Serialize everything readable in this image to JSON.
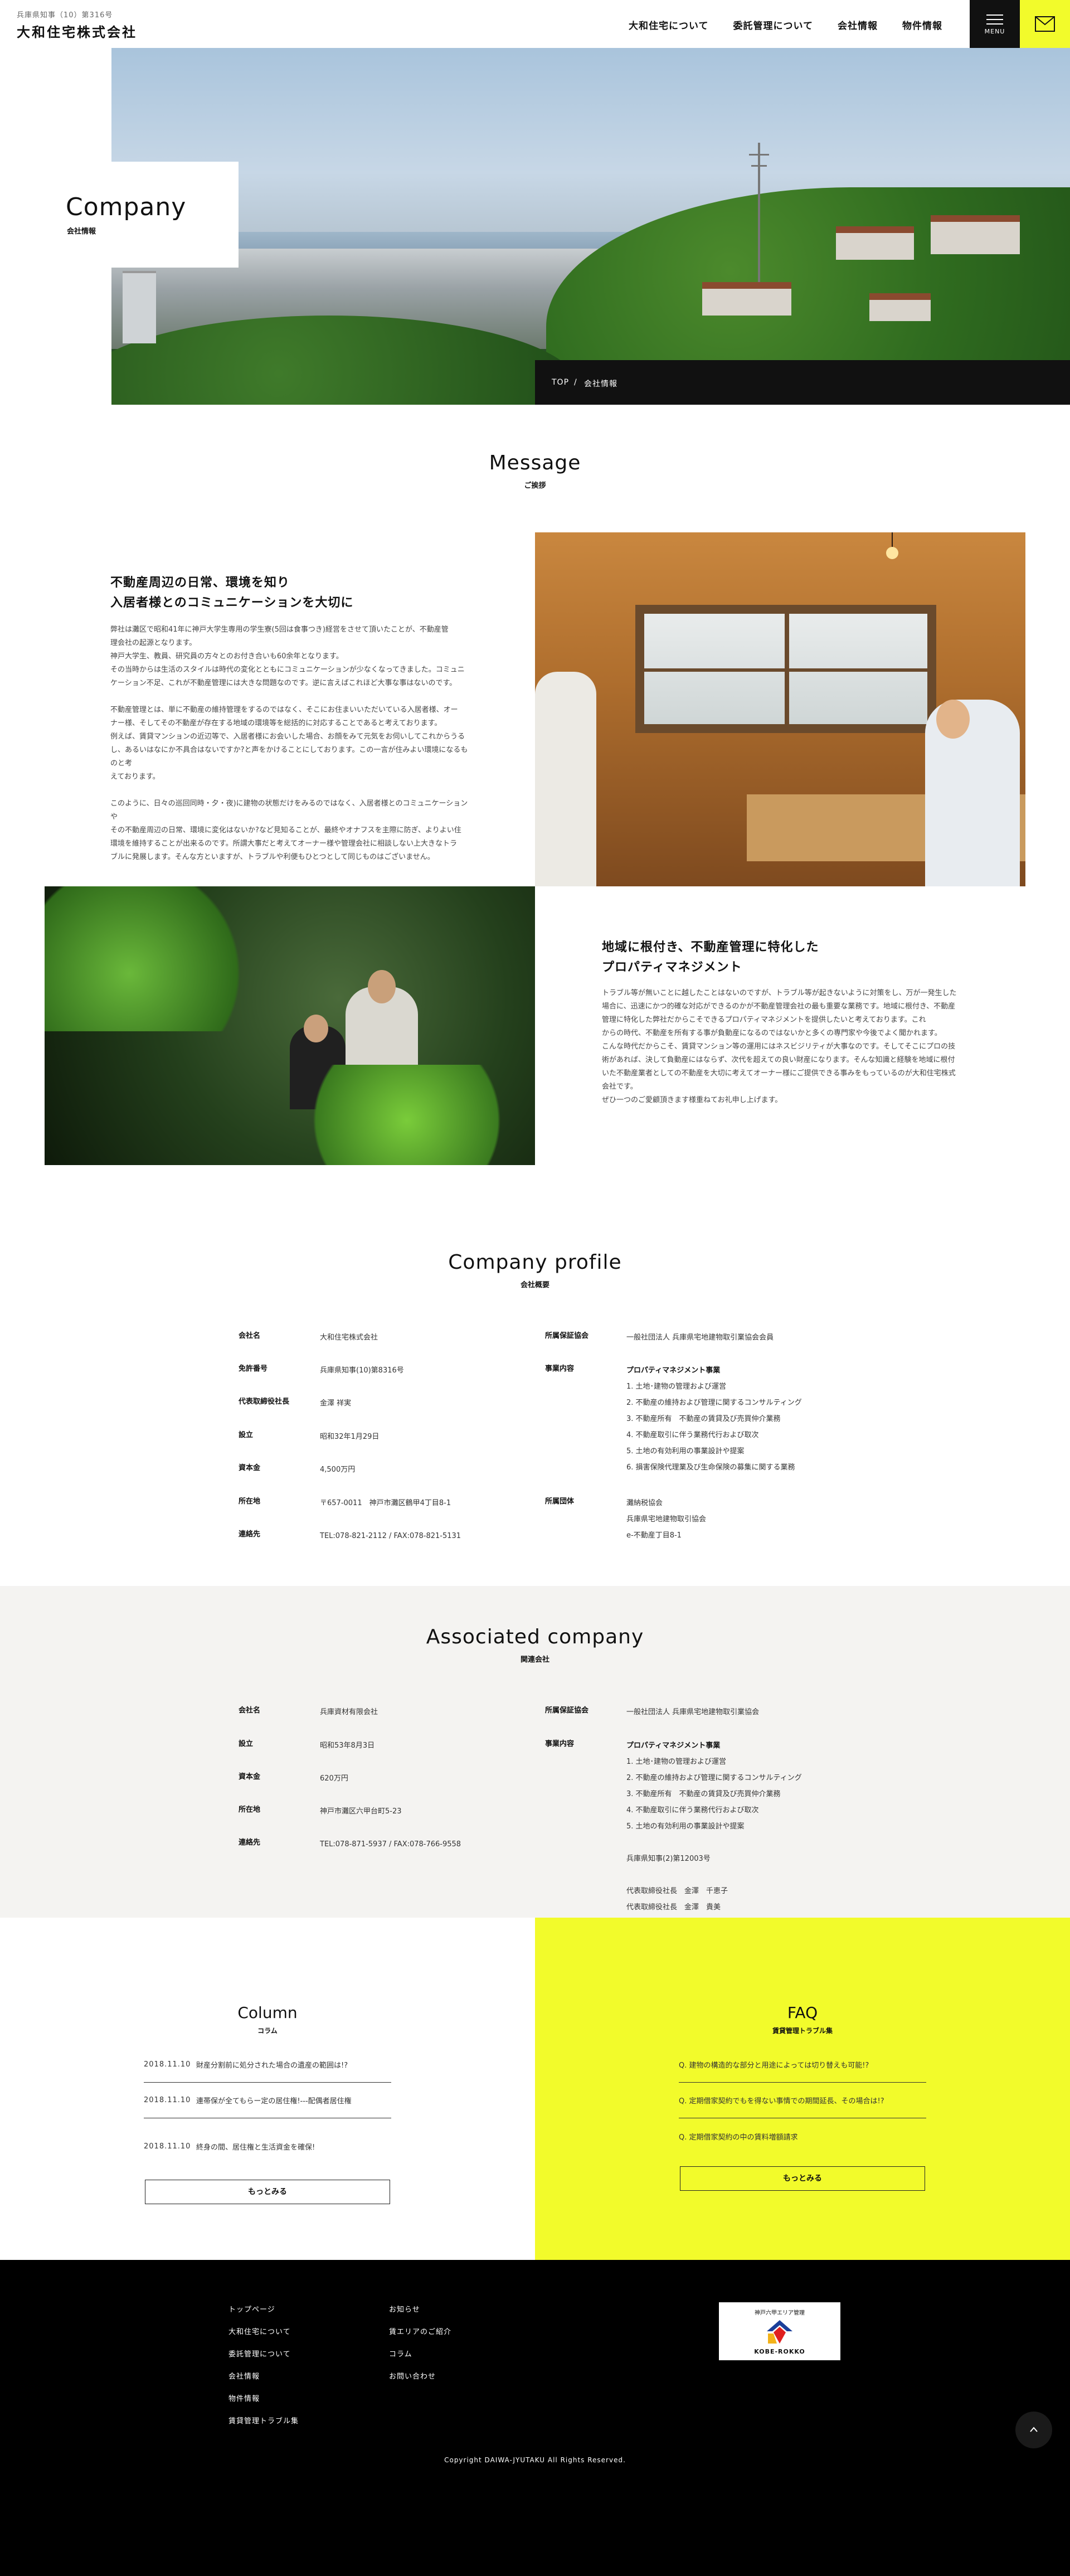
{
  "header": {
    "license": "兵庫県知事（10）第316号",
    "logo": "大和住宅株式会社",
    "nav": [
      "大和住宅について",
      "委託管理について",
      "会社情報",
      "物件情報"
    ],
    "menu_label": "MENU"
  },
  "hero": {
    "title_en": "Company",
    "title_jp": "会社情報",
    "breadcrumb": [
      "TOP",
      "/",
      "会社情報"
    ]
  },
  "message": {
    "title_en": "Message",
    "title_jp": "ご挨拶",
    "block1": {
      "heading": [
        "不動産周辺の日常、環境を知り",
        "入居者様とのコミュニケーションを大切に"
      ],
      "paragraphs": [
        [
          "弊社は灘区で昭和41年に神戸大学生専用の学生寮(5回は食事つき)経営をさせて頂いたことが、不動産管",
          "理会社の起源となります。",
          "神戸大学生、教員、研究員の方々とのお付き合いも60余年となります。",
          "その当時からは生活のスタイルは時代の変化とともにコミュニケーションが少なくなってきました。コミュニ",
          "ケーション不足、これが不動産管理には大きな問題なのです。逆に言えばこれほど大事な事はないのです。"
        ],
        [
          "不動産管理とは、単に不動産の維持管理をするのではなく、そこにお住まいいただいている入居者様、オー",
          "ナー様、そしてその不動産が存在する地域の環境等を総括的に対応することであると考えております。",
          "例えば、賃貸マンションの近辺等で、入居者様にお会いした場合、お顔をみて元気をお伺いしてこれからうる",
          "し、あるいはなにか不具合はないですか?と声をかけることにしております。この一言が住みよい環境になるものと考",
          "えております。"
        ],
        [
          "このように、日々の巡回同時・夕・夜)に建物の状態だけをみるのではなく、入居者様とのコミュニケーションや",
          "その不動産周辺の日常、環境に変化はないか?など見知ることが、最終やオナフスを主際に防ぎ、よりよい住",
          "環境を維持することが出来るのです。所謂大事だと考えてオーナー様や管理会社に相談しない上大きなトラ",
          "ブルに発展します。そんな方といますが、トラブルや利便もひとつとして同じものはございません。"
        ]
      ]
    },
    "block2": {
      "heading": [
        "地域に根付き、不動産管理に特化した",
        "プロパティマネジメント"
      ],
      "paragraph": [
        "トラブル等が無いことに越したことはないのですが、トラブル等が起きないように対策をし、万が一発生した",
        "場合に、迅速にかつ的確な対応ができるのかが不動産管理会社の最も重要な業務です。地域に根付き、不動産",
        "管理に特化した弊社だからこそできるプロパティマネジメントを提供したいと考えております。これ",
        "からの時代、不動産を所有する事が負動産になるのではないかと多くの専門家や今後でよく聞かれます。",
        "こんな時代だからこそ、賃貸マンション等の運用にはネスビジリティが大事なのです。そしてそこにプロの技",
        "術があれば、決して負動産にはならず、次代を超えての良い財産になります。そんな知識と経験を地域に根付",
        "いた不動産業者としての不動産を大切に考えてオーナー様にご提供できる事みをもっているのが大和住宅株式",
        "会社です。",
        "ぜひ一つのご愛顧頂きます様重ねてお礼申し上げます。"
      ]
    }
  },
  "profile": {
    "title_en": "Company profile",
    "title_jp": "会社概要",
    "left": [
      {
        "k": "会社名",
        "v": [
          "大和住宅株式会社"
        ]
      },
      {
        "k": "免許番号",
        "v": [
          "兵庫県知事(10)第8316号"
        ]
      },
      {
        "k": "代表取締役社長",
        "v": [
          "金澤 祥実"
        ]
      },
      {
        "k": "設立",
        "v": [
          "昭和32年1月29日"
        ]
      },
      {
        "k": "資本金",
        "v": [
          "4,500万円"
        ]
      },
      {
        "k": "所在地",
        "v": [
          "〒657-0011　神戸市灘区鶴甲4丁目8-1"
        ]
      },
      {
        "k": "連絡先",
        "v": [
          "TEL:078-821-2112 / FAX:078-821-5131"
        ]
      }
    ],
    "right": [
      {
        "k": "所属保証協会",
        "v": [
          "一般社団法人 兵庫県宅地建物取引業協会会員"
        ]
      },
      {
        "k": "事業内容",
        "v": [
          "プロパティマネジメント事業",
          "1. 土地･建物の管理および運営",
          "2. 不動産の維持および管理に関するコンサルティング",
          "3. 不動産所有　不動産の賃貸及び売買仲介業務",
          "4. 不動産取引に伴う業務代行および取次",
          "5. 土地の有効利用の事業設計や提案",
          "6. 損害保険代理業及び生命保険の募集に関する業務"
        ]
      },
      {
        "k": "所属団体",
        "v": [
          "灘納税協会",
          "兵庫県宅地建物取引協会",
          "e-不動産丁目8-1"
        ]
      }
    ]
  },
  "associated": {
    "title_en": "Associated company",
    "title_jp": "関連会社",
    "left": [
      {
        "k": "会社名",
        "v": [
          "兵庫資材有限会社"
        ]
      },
      {
        "k": "設立",
        "v": [
          "昭和53年8月3日"
        ]
      },
      {
        "k": "資本金",
        "v": [
          "620万円"
        ]
      },
      {
        "k": "所在地",
        "v": [
          "神戸市灘区六甲台町5-23"
        ]
      },
      {
        "k": "連絡先",
        "v": [
          "TEL:078-871-5937 / FAX:078-766-9558"
        ]
      }
    ],
    "right": [
      {
        "k": "所属保証協会",
        "v": [
          "一般社団法人 兵庫県宅地建物取引業協会"
        ]
      },
      {
        "k": "事業内容",
        "v": [
          "プロパティマネジメント事業",
          "1. 土地･建物の管理および運営",
          "2. 不動産の維持および管理に関するコンサルティング",
          "3. 不動産所有　不動産の賃貸及び売買仲介業務",
          "4. 不動産取引に伴う業務代行および取次",
          "5. 土地の有効利用の事業設計や提案",
          "",
          "兵庫県知事(2)第12003号",
          "",
          "代表取締役社長　金澤　千恵子",
          "代表取締役社長　金澤　貴美"
        ]
      }
    ]
  },
  "column": {
    "title_en": "Column",
    "title_jp": "コラム",
    "items": [
      {
        "date": "2018.11.10",
        "text": "財産分割前に処分された場合の遺産の範囲は!?"
      },
      {
        "date": "2018.11.10",
        "text": "連帯保が全てもらー定の居住権!---配偶者居住権"
      },
      {
        "date": "2018.11.10",
        "text": "終身の間、居住権と生活資金を確保!"
      }
    ],
    "more": "もっとみる"
  },
  "faq": {
    "title_en": "FAQ",
    "title_jp": "賃貸管理トラブル集",
    "items": [
      "Q. 建物の構造的な部分と用途によっては切り替えも可能!?",
      "Q. 定期借家契約でもを得ない事情での期間延長、その場合は!?",
      "Q. 定期借家契約の中の賃料増額請求"
    ],
    "more": "もっとみる"
  },
  "footer": {
    "col1": [
      "トップページ",
      "大和住宅について",
      "委託管理について",
      "会社情報",
      "物件情報",
      "賃貸管理トラブル集"
    ],
    "col2": [
      "お知らせ",
      "賃エリアのご紹介",
      "コラム",
      "お問い合わせ"
    ],
    "badge_top": "神戸六甲エリア管理",
    "badge_bottom": "KOBE-ROKKO",
    "copyright": "Copyright  DAIWA-JYUTAKU All Rights Reserved."
  },
  "colors": {
    "accent": "#f2fb2b",
    "dark": "#111111",
    "assoc_bg": "#f4f3f1"
  }
}
